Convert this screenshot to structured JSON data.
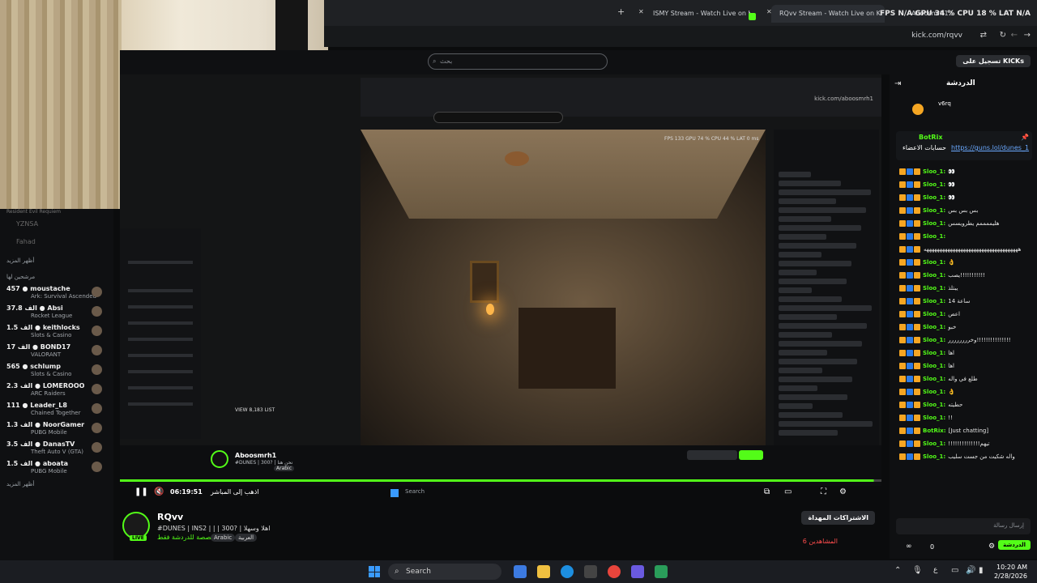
{
  "browser": {
    "tabs": [
      {
        "label": "ISMY Stream - Watch Live on K"
      },
      {
        "label": "RQvv Stream - Watch Live on K",
        "active": true
      },
      {
        "label": "Aboosmrh1 Stream - Watch Li"
      }
    ],
    "url": "kick.com/rqvv",
    "perf_overlay": "FPS N/A   GPU 34 %   CPU 18 %   LAT N/A"
  },
  "header": {
    "search_placeholder": "بحث",
    "login_label": "تسجيل على KICKs"
  },
  "sidebar": {
    "title_recommended": "مرشحين لها",
    "title_more": "أظهر المزيد",
    "hidden_users": [
      "YZNSA",
      "Fahad"
    ],
    "items": [
      {
        "name": "moustache",
        "viewers": "457",
        "category": "Ark: Survival Ascended"
      },
      {
        "name": "Absi",
        "viewers": "37.8 الف",
        "category": "Rocket League"
      },
      {
        "name": "keithlocks",
        "viewers": "1.5 الف",
        "category": "Slots & Casino"
      },
      {
        "name": "BOND17",
        "viewers": "17 الف",
        "category": "VALORANT"
      },
      {
        "name": "schlump",
        "viewers": "565",
        "category": "Slots & Casino"
      },
      {
        "name": "LOMEROOO",
        "viewers": "2.3 الف",
        "category": "ARC Raiders"
      },
      {
        "name": "Leader_L8",
        "viewers": "111",
        "category": "Chained Together"
      },
      {
        "name": "NoorGamer",
        "viewers": "1.3 الف",
        "category": "PUBG Mobile"
      },
      {
        "name": "DanasTV",
        "viewers": "3.5 الف",
        "category": "Theft Auto V (GTA)"
      },
      {
        "name": "aboata",
        "viewers": "1.5 الف",
        "category": "PUBG Mobile"
      }
    ],
    "footer": "أظهر المزيد",
    "top_game": "Resident Evil Requiem"
  },
  "inner_stream": {
    "url": "kick.com/aboosmrh1",
    "streamer": "Aboosmrh1",
    "title": "#DUNES | 300? | نحن هنا",
    "tag": "Arabic",
    "overlay_label": "VIEW 8,183 LIST",
    "perf_overlay": "FPS 133   GPU 74 %   CPU 44 %   LAT 0 ms",
    "search_label": "Search"
  },
  "player": {
    "time": "06:19:51",
    "go_live": "اذهب إلى المباشر"
  },
  "stream_info": {
    "streamer": "RQvv",
    "live_badge": "LIVE",
    "title": "#DUNES | INS2 | | | 300? | اهلا وسهلا",
    "category": "محصصة للدردشة فقط",
    "tags": [
      "Arabic",
      "العربية"
    ],
    "follow_label": "الاشتراكات المهداة",
    "viewers": "6 المشاهدين"
  },
  "chat": {
    "title": "الدردشة",
    "leader": "v6rq",
    "pinned_user": "BotRix",
    "pinned_text": "حسابات الاعضاء",
    "pinned_link": "https://guns.lol/dunes_1",
    "messages": [
      {
        "user": "Sloo_1:",
        "msg": "👀"
      },
      {
        "user": "Sloo_1:",
        "msg": "👀"
      },
      {
        "user": "Sloo_1:",
        "msg": "👀"
      },
      {
        "user": "Sloo_1:",
        "msg": "بس بس بس"
      },
      {
        "user": "Sloo_1:",
        "msg": "هليممممم يطرويسس"
      },
      {
        "user": "Sloo_1:",
        "msg": ""
      },
      {
        "user": "",
        "msg": "ههههههههههههههههههههههههههههههههههههه"
      },
      {
        "user": "Sloo_1:",
        "msg": "👌"
      },
      {
        "user": "Sloo_1:",
        "msg": "يصب!!!!!!!!!!!"
      },
      {
        "user": "Sloo_1:",
        "msg": "يبتلذ"
      },
      {
        "user": "Sloo_1:",
        "msg": "ساعة 14"
      },
      {
        "user": "Sloo_1:",
        "msg": "اعص"
      },
      {
        "user": "Sloo_1:",
        "msg": "خبو"
      },
      {
        "user": "Sloo_1:",
        "msg": "وخرررررررر!!!!!!!!!!!!!!!"
      },
      {
        "user": "Sloo_1:",
        "msg": "اها"
      },
      {
        "user": "Sloo_1:",
        "msg": "اها"
      },
      {
        "user": "Sloo_1:",
        "msg": "طلع في واله"
      },
      {
        "user": "Sloo_1:",
        "msg": "👌"
      },
      {
        "user": "Sloo_1:",
        "msg": "حطيته"
      },
      {
        "user": "Sloo_1:",
        "msg": "!!"
      },
      {
        "user": "BotRix:",
        "msg": "[Just chatting]"
      },
      {
        "user": "Sloo_1:",
        "msg": "!!!!!!!!!!!!!!تيهم"
      },
      {
        "user": "Sloo_1:",
        "msg": "واله شكيت من جست سليب"
      }
    ],
    "input_placeholder": "إرسال رسالة",
    "points": "0",
    "send_label": "الدردشة"
  },
  "taskbar": {
    "search_label": "Search",
    "time": "10:20 AM",
    "date": "2/28/2026",
    "lang": "ع"
  }
}
